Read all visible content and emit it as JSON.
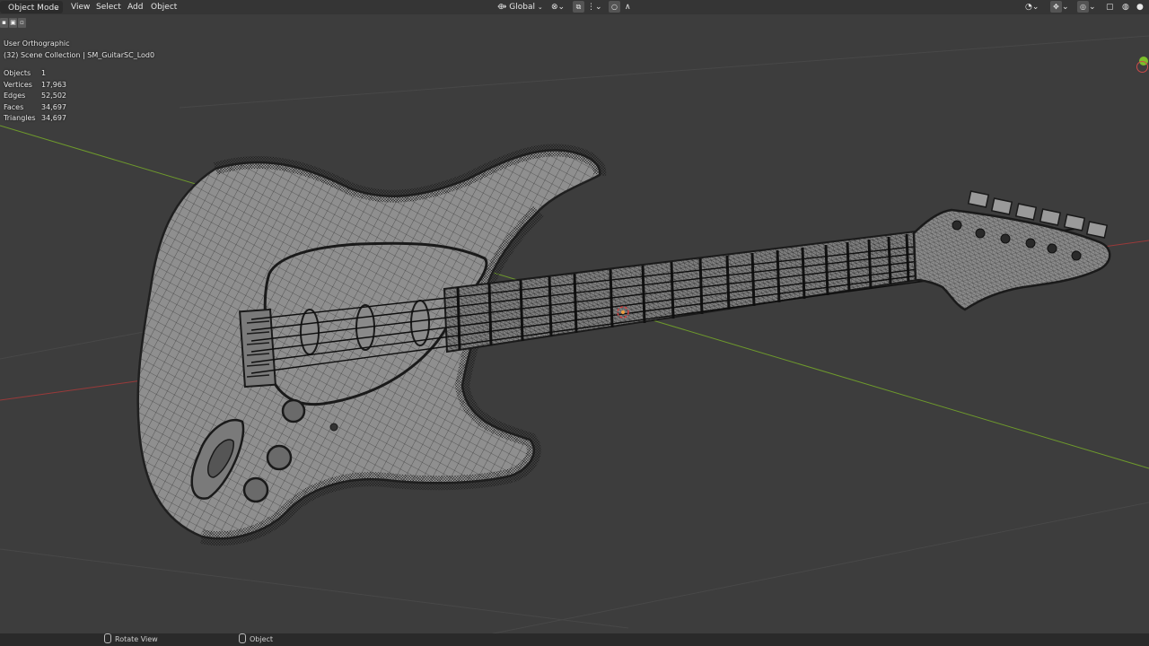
{
  "header": {
    "mode": "Object Mode",
    "menus": [
      "View",
      "Select",
      "Add",
      "Object"
    ],
    "orientation": "Global"
  },
  "overlay": {
    "view_name": "User Orthographic",
    "collection": "(32) Scene Collection | SM_GuitarSC_Lod0"
  },
  "stats": [
    {
      "label": "Objects",
      "value": "1"
    },
    {
      "label": "Vertices",
      "value": "17,963"
    },
    {
      "label": "Edges",
      "value": "52,502"
    },
    {
      "label": "Faces",
      "value": "34,697"
    },
    {
      "label": "Triangles",
      "value": "34,697"
    }
  ],
  "footer": {
    "items": [
      "Rotate View",
      "Object"
    ]
  },
  "colors": {
    "viewport_bg": "#3d3d3d",
    "x_axis": "#9a3a3a",
    "y_axis": "#6e9a2c",
    "mesh_fill": "#8f8f8f",
    "wire": "#1f1f1f"
  }
}
